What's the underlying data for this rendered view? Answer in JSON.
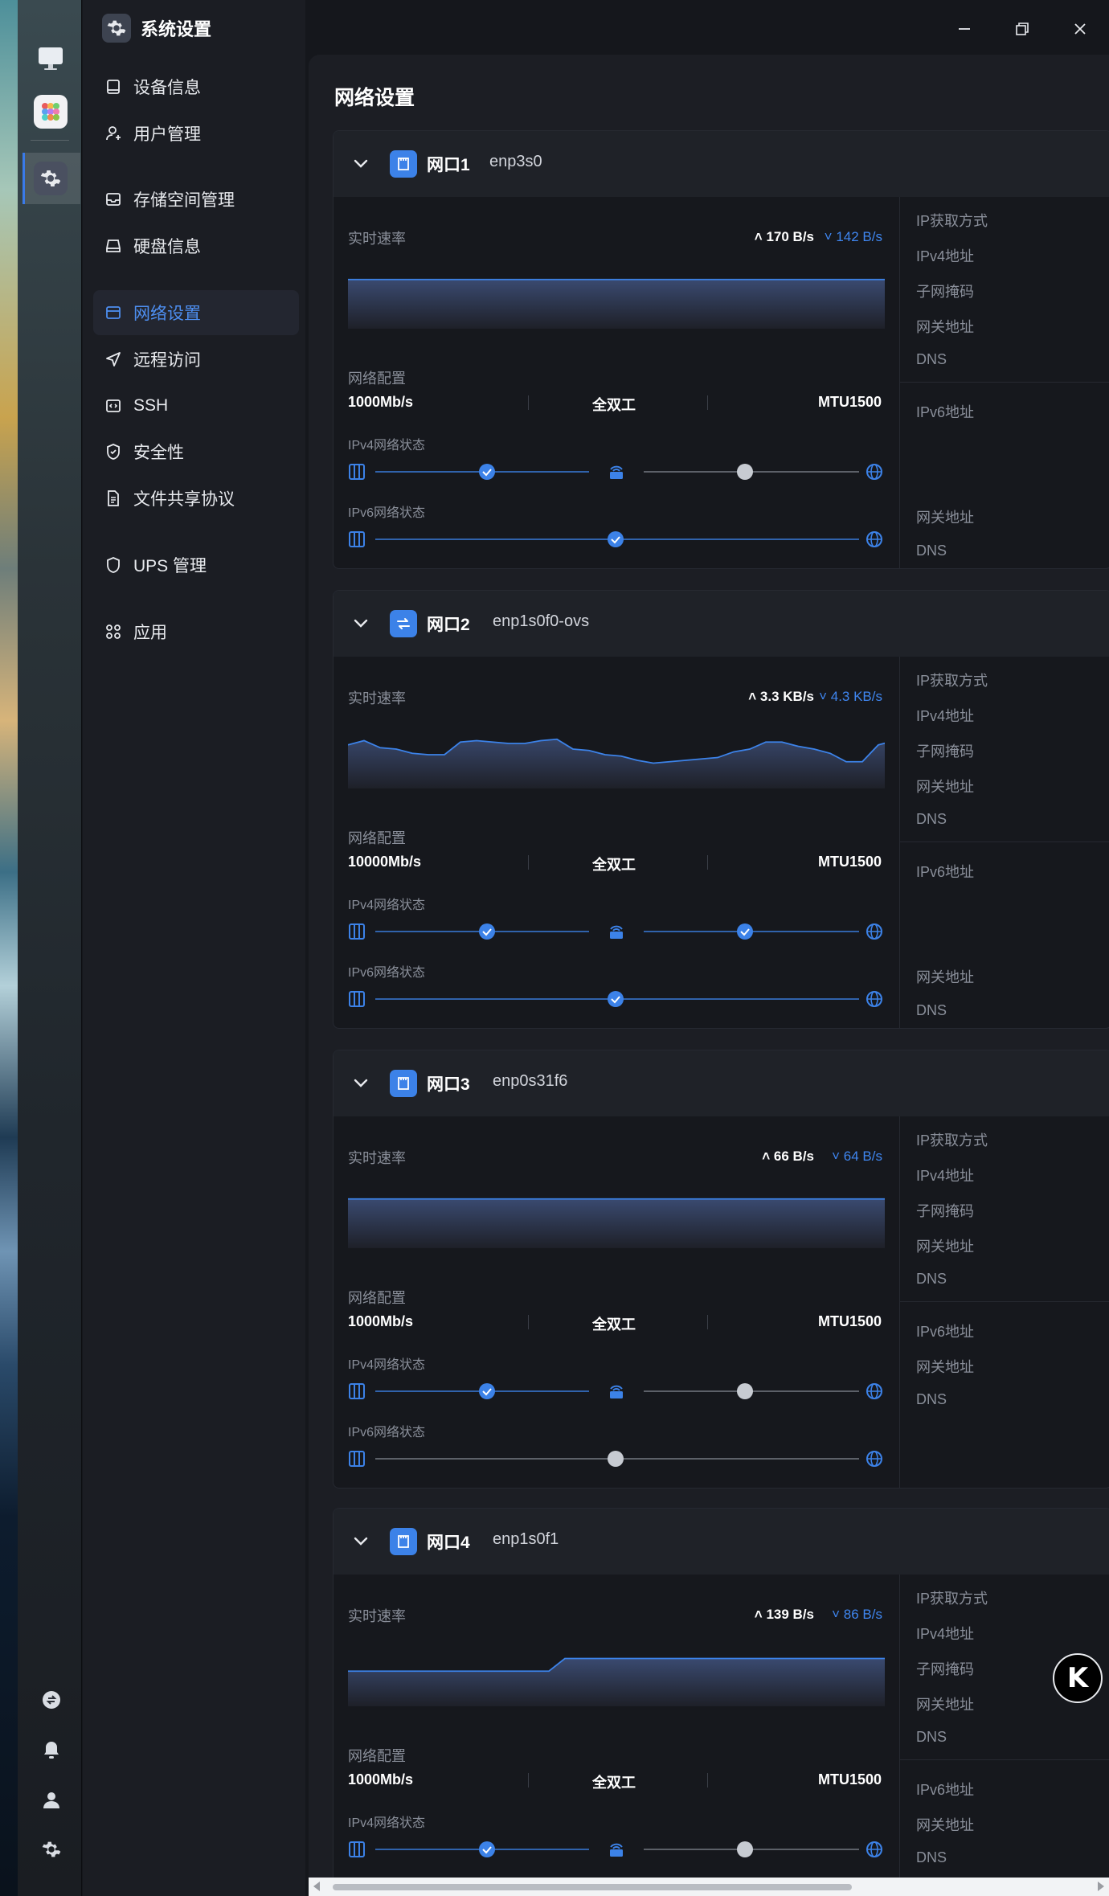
{
  "window": {
    "title": "系统设置",
    "controls": [
      "minimize-icon",
      "maximize-icon",
      "close-icon"
    ]
  },
  "sidebar": {
    "items": [
      {
        "label": "设备信息",
        "icon": "device-icon"
      },
      {
        "label": "用户管理",
        "icon": "user-icon"
      },
      {
        "label": "存储空间管理",
        "icon": "storage-icon"
      },
      {
        "label": "硬盘信息",
        "icon": "disk-icon"
      },
      {
        "label": "网络设置",
        "icon": "network-icon",
        "active": true
      },
      {
        "label": "远程访问",
        "icon": "send-icon"
      },
      {
        "label": "SSH",
        "icon": "code-icon"
      },
      {
        "label": "安全性",
        "icon": "shield-check-icon"
      },
      {
        "label": "文件共享协议",
        "icon": "file-icon"
      },
      {
        "label": "UPS 管理",
        "icon": "shield-icon"
      },
      {
        "label": "应用",
        "icon": "apps-icon"
      }
    ]
  },
  "main": {
    "title": "网络设置",
    "labels": {
      "rate": "实时速率",
      "config": "网络配置",
      "ipv4_status": "IPv4网络状态",
      "ipv6_status": "IPv6网络状态"
    },
    "ports": [
      {
        "name": "网口1",
        "iface": "enp3s0",
        "icon": "ethernet-port-icon",
        "up": "170 B/s",
        "down": "142 B/s",
        "speed": "1000Mb/s",
        "duplex": "全双工",
        "mtu": "MTU1500",
        "ipv4": {
          "link": "ok",
          "router": "ok",
          "internet": "none"
        },
        "ipv6": {
          "link": "ok"
        },
        "right_top": [
          "IP获取方式",
          "IPv4地址",
          "子网掩码",
          "网关地址",
          "DNS"
        ],
        "right_bottom": [
          "IPv6地址",
          "网关地址",
          "DNS"
        ]
      },
      {
        "name": "网口2",
        "iface": "enp1s0f0-ovs",
        "icon": "transfer-icon",
        "up": "3.3 KB/s",
        "down": "4.3 KB/s",
        "speed": "10000Mb/s",
        "duplex": "全双工",
        "mtu": "MTU1500",
        "ipv4": {
          "link": "ok",
          "router": "ok",
          "internet": "ok"
        },
        "ipv6": {
          "link": "ok"
        },
        "right_top": [
          "IP获取方式",
          "IPv4地址",
          "子网掩码",
          "网关地址",
          "DNS"
        ],
        "right_bottom": [
          "IPv6地址",
          "网关地址",
          "DNS"
        ]
      },
      {
        "name": "网口3",
        "iface": "enp0s31f6",
        "icon": "ethernet-port-icon",
        "up": "66 B/s",
        "down": "64 B/s",
        "speed": "1000Mb/s",
        "duplex": "全双工",
        "mtu": "MTU1500",
        "ipv4": {
          "link": "ok",
          "router": "ok",
          "internet": "none"
        },
        "ipv6": {
          "link": "none"
        },
        "right_top": [
          "IP获取方式",
          "IPv4地址",
          "子网掩码",
          "网关地址",
          "DNS"
        ],
        "right_bottom": [
          "IPv6地址",
          "网关地址",
          "DNS"
        ]
      },
      {
        "name": "网口4",
        "iface": "enp1s0f1",
        "icon": "ethernet-port-icon",
        "up": "139 B/s",
        "down": "86 B/s",
        "speed": "1000Mb/s",
        "duplex": "全双工",
        "mtu": "MTU1500",
        "ipv4": {
          "link": "ok",
          "router": "ok",
          "internet": "none"
        },
        "ipv6": {
          "link": "ok"
        },
        "right_top": [
          "IP获取方式",
          "IPv4地址",
          "子网掩码",
          "网关地址",
          "DNS"
        ],
        "right_bottom": [
          "IPv6地址",
          "网关地址",
          "DNS"
        ]
      }
    ]
  },
  "colors": {
    "accent": "#3c82e8",
    "bg": "#15171c",
    "card": "#16181d",
    "muted": "#8a8f9a"
  },
  "badge": {
    "icon": "k-logo-icon"
  }
}
